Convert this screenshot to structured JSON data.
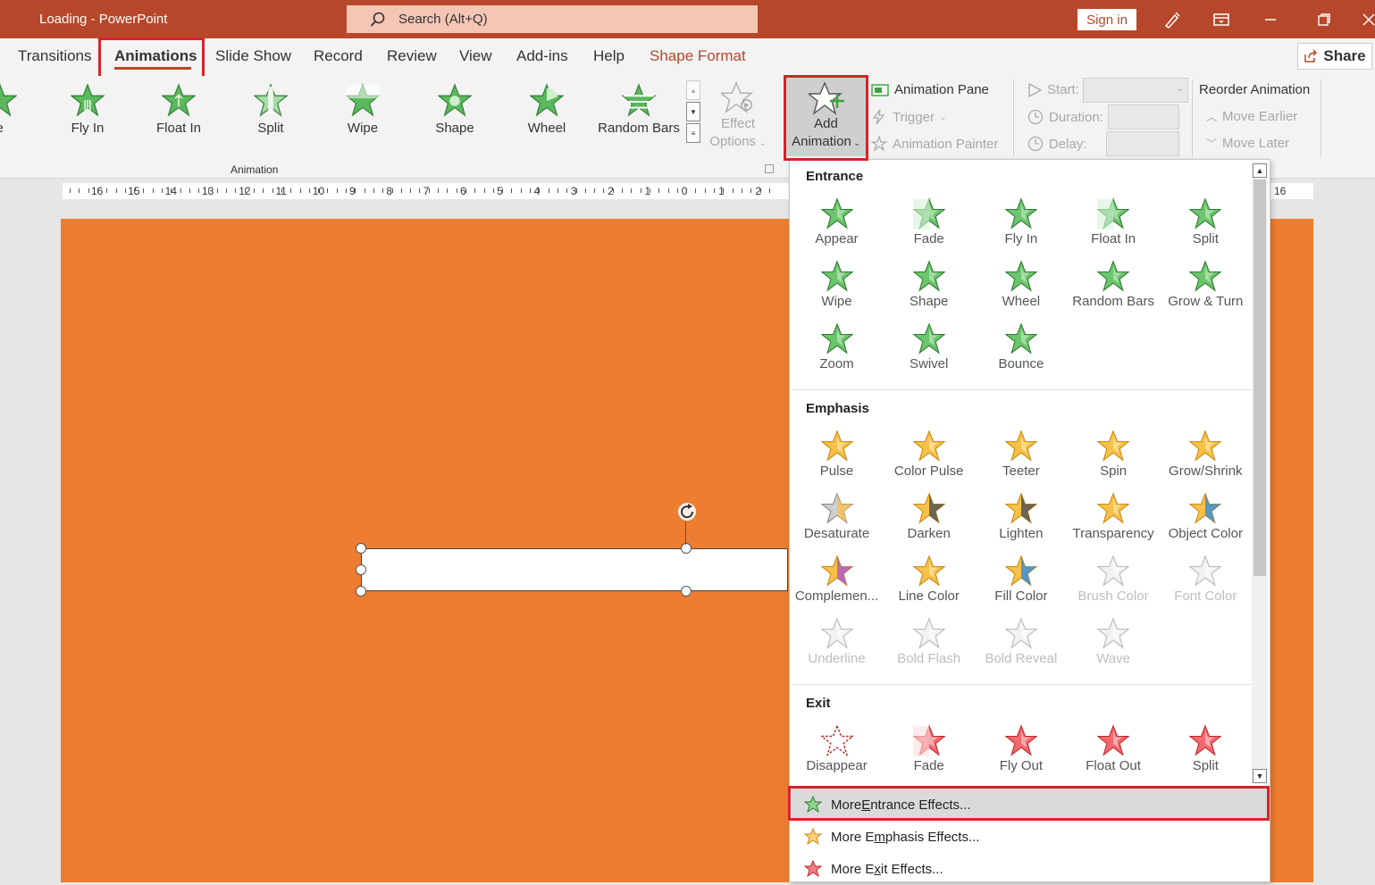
{
  "titlebar": {
    "title": "Loading  -  PowerPoint",
    "search_placeholder": "Search (Alt+Q)",
    "signin": "Sign in"
  },
  "tabs": [
    "Transitions",
    "Animations",
    "Slide Show",
    "Record",
    "Review",
    "View",
    "Add-ins",
    "Help",
    "Shape Format"
  ],
  "share": "Share",
  "gallery": [
    "le",
    "Fly In",
    "Float In",
    "Split",
    "Wipe",
    "Shape",
    "Wheel",
    "Random Bars"
  ],
  "effect_options": [
    "Effect",
    "Options"
  ],
  "group_label": "Animation",
  "add_animation": [
    "Add",
    "Animation"
  ],
  "advanced": {
    "pane": "Animation Pane",
    "trigger": "Trigger",
    "painter": "Animation Painter"
  },
  "timing": {
    "start": "Start:",
    "duration": "Duration:",
    "delay": "Delay:"
  },
  "reorder": {
    "title": "Reorder Animation",
    "earlier": "Move Earlier",
    "later": "Move Later"
  },
  "ruler_ticks": [
    "16",
    "15",
    "14",
    "13",
    "12",
    "11",
    "10",
    "9",
    "8",
    "7",
    "6",
    "5",
    "4",
    "3",
    "2",
    "1",
    "0",
    "1",
    "2"
  ],
  "ruler_right": "16",
  "dropdown": {
    "entrance_title": "Entrance",
    "entrance": [
      "Appear",
      "Fade",
      "Fly In",
      "Float In",
      "Split",
      "Wipe",
      "Shape",
      "Wheel",
      "Random Bars",
      "Grow & Turn",
      "Zoom",
      "Swivel",
      "Bounce"
    ],
    "emphasis_title": "Emphasis",
    "emphasis": [
      "Pulse",
      "Color Pulse",
      "Teeter",
      "Spin",
      "Grow/Shrink",
      "Desaturate",
      "Darken",
      "Lighten",
      "Transparency",
      "Object Color",
      "Complemen...",
      "Line Color",
      "Fill Color",
      "Brush Color",
      "Font Color",
      "Underline",
      "Bold Flash",
      "Bold Reveal",
      "Wave"
    ],
    "exit_title": "Exit",
    "exit": [
      "Disappear",
      "Fade",
      "Fly Out",
      "Float Out",
      "Split"
    ],
    "more": [
      {
        "pre": "More ",
        "u": "E",
        "post": "ntrance Effects..."
      },
      {
        "pre": "More E",
        "u": "m",
        "post": "phasis Effects..."
      },
      {
        "pre": "More E",
        "u": "x",
        "post": "it Effects..."
      }
    ]
  },
  "colors": {
    "accent": "#b7472a",
    "slide": "#ed7d31",
    "highlight": "#d9222a",
    "entrance": "#5cb85c",
    "emphasis": "#f0a830",
    "exit": "#e0454a"
  }
}
